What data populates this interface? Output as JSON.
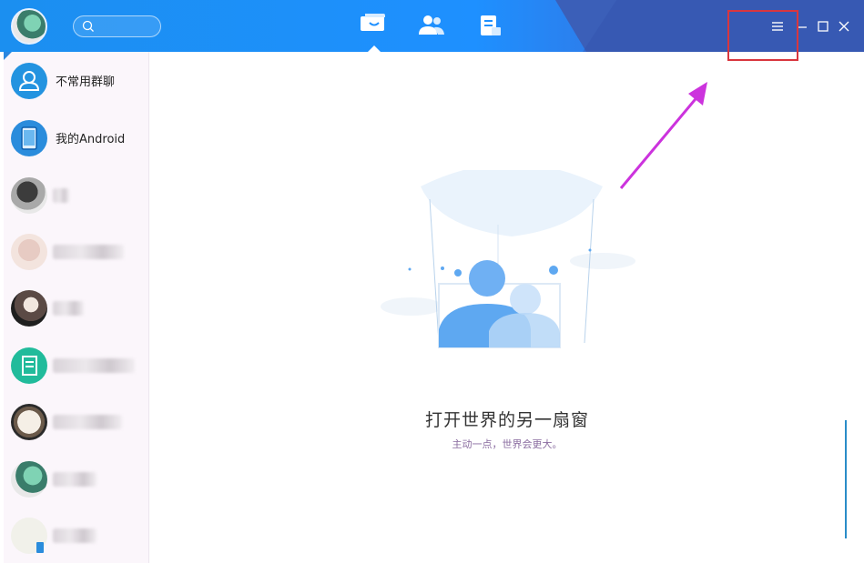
{
  "titlebar": {
    "tabs": [
      {
        "name": "messages",
        "active": true
      },
      {
        "name": "contacts",
        "active": false
      },
      {
        "name": "notes",
        "active": false
      }
    ],
    "icons": {
      "search": "search-icon",
      "menu": "menu-icon",
      "minimize": "minimize-icon",
      "maximize": "maximize-icon",
      "close": "close-icon"
    }
  },
  "sidebar": {
    "items": [
      {
        "label": "不常用群聊",
        "icon": "group-icon"
      },
      {
        "label": "我的Android",
        "icon": "phone-icon"
      },
      {
        "label": ""
      },
      {
        "label": ""
      },
      {
        "label": ""
      },
      {
        "label": ""
      },
      {
        "label": ""
      },
      {
        "label": ""
      },
      {
        "label": ""
      }
    ]
  },
  "main": {
    "title": "打开世界的另一扇窗",
    "subtitle": "主动一点，世界会更大。"
  },
  "colors": {
    "accent": "#1e90ff",
    "titlebar_navy": "#3b5fb8",
    "highlight": "#d9363e",
    "arrow": "#cc33dd"
  }
}
